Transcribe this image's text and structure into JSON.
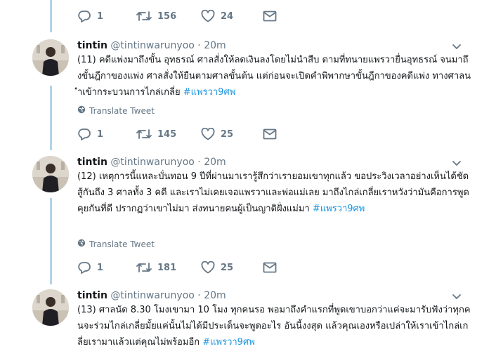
{
  "top_actions": {
    "replies": "1",
    "retweets": "156",
    "likes": "24"
  },
  "tweets": [
    {
      "name": "tintin",
      "handle": "@tintinwarunyoo",
      "separator": "·",
      "time": "20m",
      "text": "(11) คดีแพ่งมาถึงขั้น อุทธรณ์ ศาลสั่งให้ลดเงินลงโดยไม่นำสืบ  ตามที่ทนายแพรวายื่นอุทธรณ์ จนมาถึงขั้นฎีกาของแพ่ง ศาลสั่งให้ยืนตามศาลขั้นต้น  แต่ก่อนจะเปิดคำพิพากษาขั้นฎีกาของคดีแพ่ง  ทางศาลนำเข้ากระบวนการไกล่เกลี่ย ",
      "hashtag": "#แพรวา9ศพ",
      "translate": "Translate Tweet",
      "replies": "1",
      "retweets": "145",
      "likes": "25"
    },
    {
      "name": "tintin",
      "handle": "@tintinwarunyoo",
      "separator": "·",
      "time": "20m",
      "text": "(12) เหตุการนี้แหละบั่นทอน 9 ปีที่ผ่านมาเรารู้สึกว่าเรายอมเขาทุกแล้ว ขอประวิงเวลาอย่างเห็นได้ชัด สู้กันถึง 3 ศาลทั้ง 3 คดี และเราไม่เคยเจอแพรวาและพ่อแม่เลย มาถึงไกล่เกลี่ยเราหวังว่ามันคือการพูดคุยกันที่ดี ปรากฏว่าเขาไม่มา ส่งทนายคนผู้เป็นญาติฝั่งแม่มา ",
      "hashtag": "#แพรวา9ศพ",
      "translate": "Translate Tweet",
      "replies": "1",
      "retweets": "181",
      "likes": "25"
    },
    {
      "name": "tintin",
      "handle": "@tintinwarunyoo",
      "separator": "·",
      "time": "20m",
      "text": "(13) ศาลนัด 8.30 โมงเขามา 10 โมง ทุกคนรอ พอมาถึงคำแรกที่พูดเขาบอกว่าแค่จะมารับฟังว่าทุกคนจะร่วมไกล่เกลี่ยมั้ยแค่นั้นไม่ได้มีประเด็นจะพูดอะไร อันนี้งงสุด แล้วคุณเองหรือเปล่าให้เราเข้าไกล่เกลี่ยเรามาแล้วแต่คุณไม่พร้อมอีก  ",
      "hashtag": "#แพรวา9ศพ"
    }
  ]
}
